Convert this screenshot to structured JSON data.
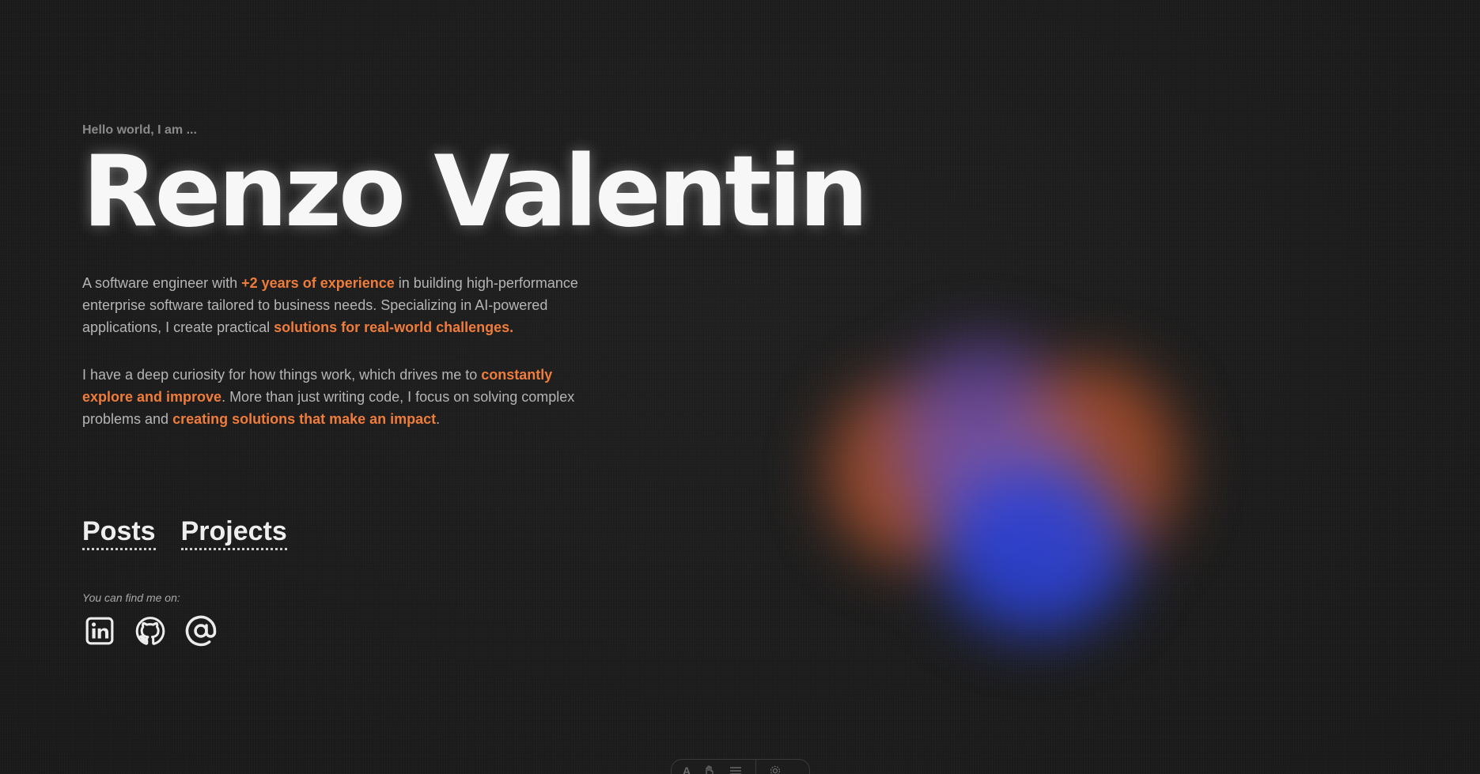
{
  "hero": {
    "greeting": "Hello world, I am ...",
    "name": "Renzo Valentin"
  },
  "bio": {
    "p1": {
      "t1": "A software engineer with ",
      "h1": "+2 years of experience",
      "t2": " in building high-performance enterprise software tailored to business needs. Specializing in AI-powered applications, I create practical ",
      "h2": "solutions for real-world challenges."
    },
    "p2": {
      "t1": "I have a deep curiosity for how things work, which drives me to ",
      "h1": "constantly explore and improve",
      "t2": ". More than just writing code, I focus on solving complex problems and ",
      "h2": "creating solutions that make an impact",
      "t3": "."
    }
  },
  "nav": {
    "posts": "Posts",
    "projects": "Projects"
  },
  "socials": {
    "label": "You can find me on:",
    "items": [
      {
        "icon": "linkedin-icon"
      },
      {
        "icon": "github-icon"
      },
      {
        "icon": "at-sign-icon"
      }
    ]
  },
  "toolbar": {
    "font": "A"
  },
  "colors": {
    "background": "#1b1b1b",
    "accent": "#f07c3c",
    "text": "#b5b5b5",
    "heading": "#f7f7f7"
  }
}
